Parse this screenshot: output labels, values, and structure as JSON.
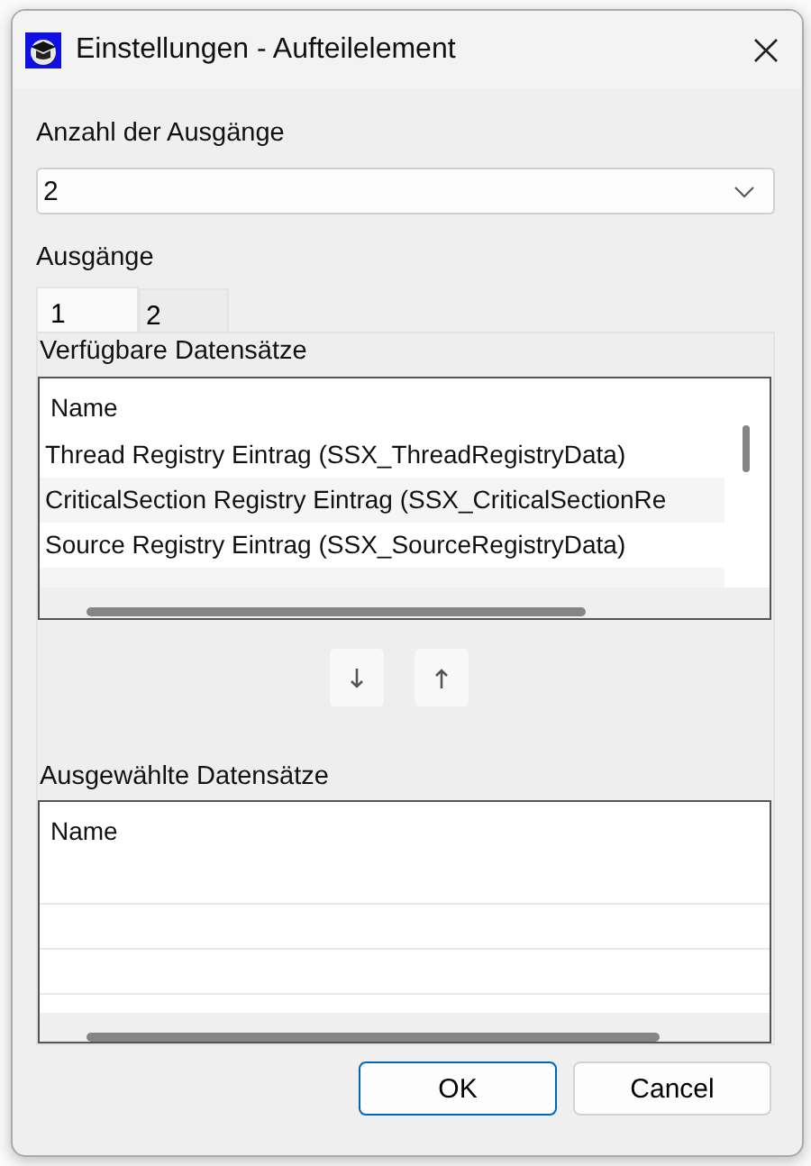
{
  "window": {
    "title": "Einstellungen - Aufteilelement"
  },
  "outputs_count": {
    "label": "Anzahl der Ausgänge",
    "value": "2"
  },
  "outputs": {
    "label": "Ausgänge",
    "tabs": [
      {
        "label": "1",
        "selected": true
      },
      {
        "label": "2",
        "selected": false
      }
    ]
  },
  "available": {
    "label": "Verfügbare Datensätze",
    "columns": [
      "Name"
    ],
    "rows": [
      "Thread Registry Eintrag (SSX_ThreadRegistryData)",
      "CriticalSection Registry Eintrag (SSX_CriticalSectionRe",
      "Source Registry Eintrag (SSX_SourceRegistryData)"
    ]
  },
  "chosen": {
    "label": "Ausgewählte Datensätze",
    "columns": [
      "Name"
    ]
  },
  "buttons": [
    {
      "label": "OK",
      "default": true
    },
    {
      "label": "Cancel",
      "default": false
    }
  ]
}
